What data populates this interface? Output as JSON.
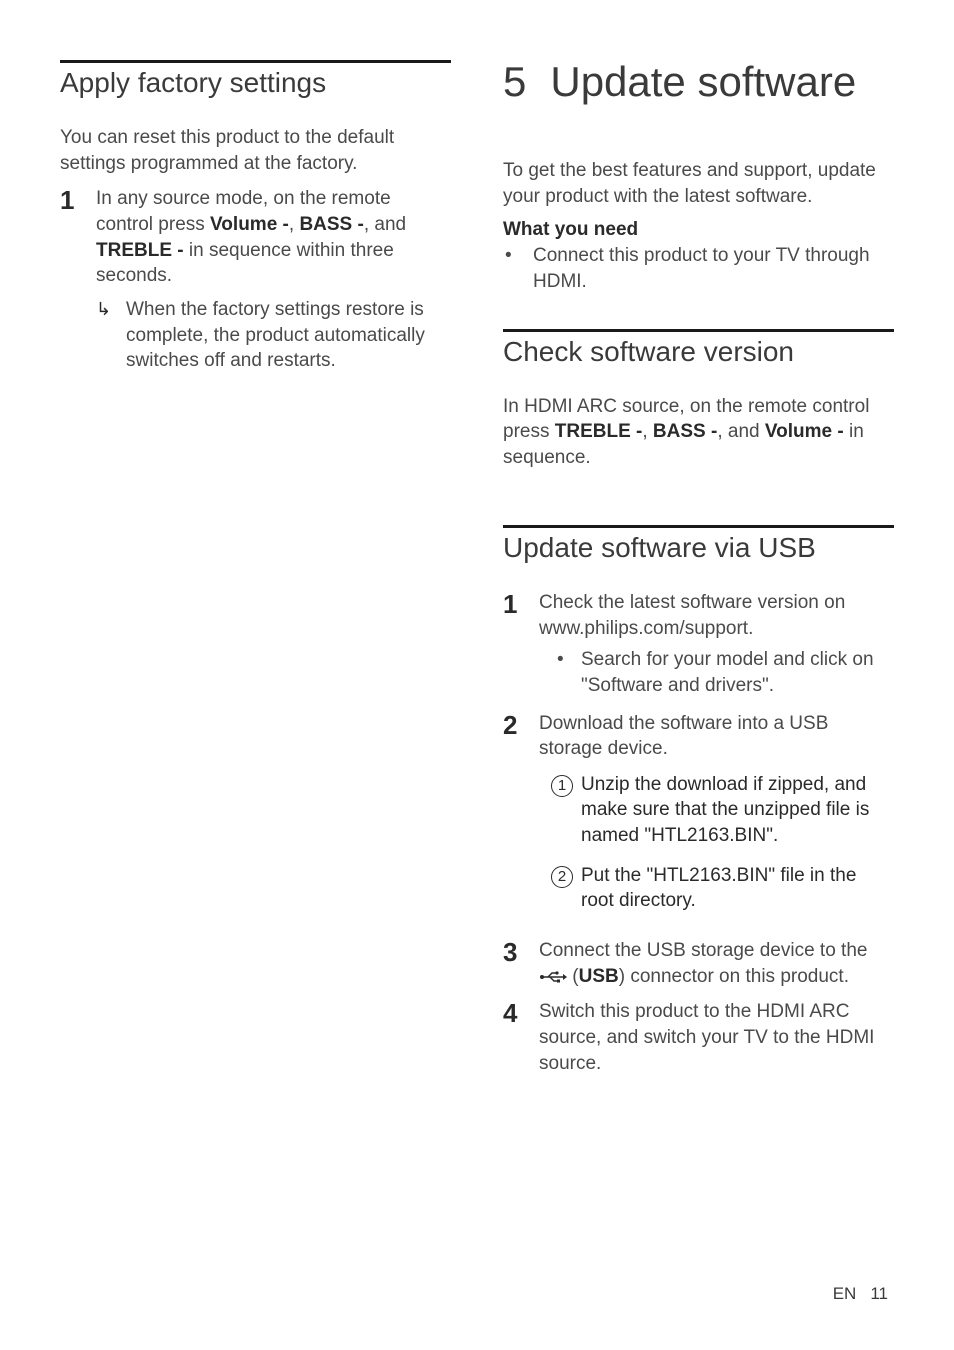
{
  "left": {
    "section_title": "Apply factory settings",
    "intro": "You can reset this product to the default settings programmed at the factory.",
    "step1": {
      "num": "1",
      "text_before": "In any source mode, on the remote control press ",
      "key1": "Volume -",
      "sep1": ", ",
      "key2": "BASS -",
      "sep2": ", and ",
      "key3": "TREBLE -",
      "text_after": " in sequence within three seconds.",
      "result": "When the factory settings restore is complete, the product automatically switches off and restarts."
    }
  },
  "right": {
    "chapter_num": "5",
    "chapter_title": "Update software",
    "intro": "To get the best features and support, update your product with the latest software.",
    "need_label": "What you need",
    "need_item": "Connect this product to your TV through HDMI.",
    "section_check": {
      "title": "Check software version",
      "text_before": "In HDMI ARC source, on the remote control press ",
      "key1": "TREBLE -",
      "sep1": ", ",
      "key2": "BASS -",
      "sep2": ", and ",
      "key3": "Volume -",
      "text_after": " in sequence."
    },
    "section_usb": {
      "title": "Update software via USB",
      "step1": {
        "num": "1",
        "text": "Check the latest software version on www.philips.com/support.",
        "sub": "Search for your model and click on \"Software and drivers\"."
      },
      "step2": {
        "num": "2",
        "text": "Download the software into a USB storage device.",
        "c1": {
          "num": "1",
          "text": "Unzip the download if zipped, and make sure that the unzipped file is named \"HTL2163.BIN\"."
        },
        "c2": {
          "num": "2",
          "text": "Put the \"HTL2163.BIN\" file in the root directory."
        }
      },
      "step3": {
        "num": "3",
        "text_before": "Connect the USB storage device to the ",
        "usb_label": "USB",
        "text_after": ") connector on this product."
      },
      "step4": {
        "num": "4",
        "text": "Switch this product to the HDMI ARC source, and switch your TV to the HDMI source."
      }
    }
  },
  "footer": {
    "lang": "EN",
    "page": "11"
  }
}
